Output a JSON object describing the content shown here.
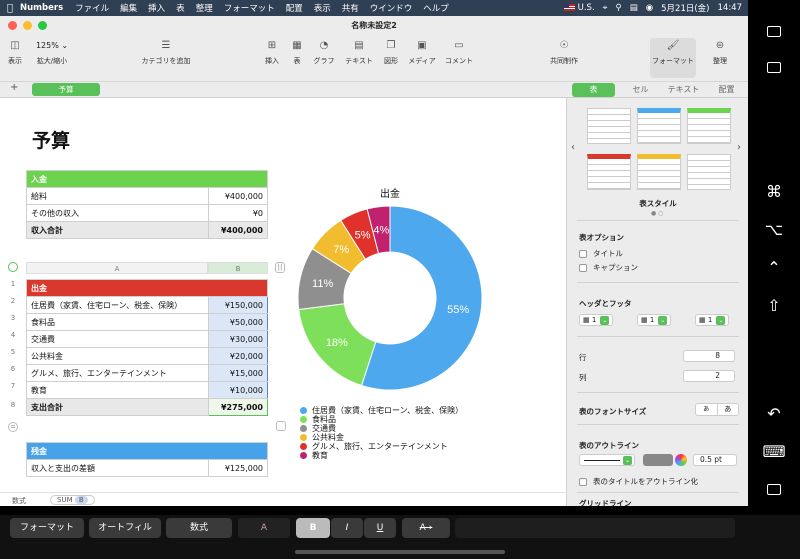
{
  "menubar": {
    "app_name": "Numbers",
    "items": [
      "ファイル",
      "編集",
      "挿入",
      "表",
      "整理",
      "フォーマット",
      "配置",
      "表示",
      "共有",
      "ウインドウ",
      "ヘルプ"
    ],
    "input_source": "U.S.",
    "date": "5月21日(金)",
    "time": "14:47"
  },
  "window": {
    "title": "名称未設定2"
  },
  "toolbar": {
    "view_label": "表示",
    "zoom_value": "125%",
    "zoom_label": "拡大/縮小",
    "add_category_label": "カテゴリを追加",
    "insert_label": "挿入",
    "table_label": "表",
    "chart_label": "グラフ",
    "text_label": "テキスト",
    "shape_label": "図形",
    "media_label": "メディア",
    "comment_label": "コメント",
    "collaborate_label": "共同制作",
    "format_label": "フォーマット",
    "organize_label": "整理"
  },
  "sheet_tab": "予算",
  "inspector_tabs": [
    "表",
    "セル",
    "テキスト",
    "配置"
  ],
  "document": {
    "title": "予算",
    "income_table": {
      "header": "入金",
      "rows": [
        [
          "給料",
          "¥400,000"
        ],
        [
          "その他の収入",
          "¥0"
        ]
      ],
      "footer": [
        "収入合計",
        "¥400,000"
      ]
    },
    "expense_table": {
      "col_headers": [
        "A",
        "B"
      ],
      "header": "出金",
      "rows": [
        [
          "住居費（家賃、住宅ローン、税金、保険）",
          "¥150,000"
        ],
        [
          "食料品",
          "¥50,000"
        ],
        [
          "交通費",
          "¥30,000"
        ],
        [
          "公共料金",
          "¥20,000"
        ],
        [
          "グルメ、旅行、エンターテインメント",
          "¥15,000"
        ],
        [
          "教育",
          "¥10,000"
        ]
      ],
      "footer": [
        "支出合計",
        "¥275,000"
      ],
      "row_numbers": [
        "1",
        "2",
        "3",
        "4",
        "5",
        "6",
        "7",
        "8"
      ]
    },
    "balance_table": {
      "header": "残金",
      "rows": [
        [
          "収入と支出の差額",
          "¥125,000"
        ]
      ]
    }
  },
  "chart_data": {
    "type": "pie",
    "title": "出金",
    "categories": [
      "住居費（家賃、住宅ローン、税金、保険）",
      "食料品",
      "交通費",
      "公共料金",
      "グルメ、旅行、エンターテインメント",
      "教育"
    ],
    "values": [
      55,
      18,
      11,
      7,
      5,
      4
    ],
    "labels": [
      "55%",
      "18%",
      "11%",
      "7%",
      "5%",
      "4%"
    ],
    "colors": [
      "#4ea8ee",
      "#7ee05a",
      "#8f8f8f",
      "#f1bc2e",
      "#e0322a",
      "#c0226e"
    ],
    "legend": "bottom"
  },
  "statusbar": {
    "label": "数式",
    "formula_fn": "SUM",
    "formula_arg": "B"
  },
  "inspector": {
    "table_style_label": "表スタイル",
    "table_options_label": "表オプション",
    "title_label": "タイトル",
    "caption_label": "キャプション",
    "headers_footers_label": "ヘッダとフッタ",
    "header_rows": "1",
    "header_cols": "1",
    "footer_rows": "1",
    "rows_label": "行",
    "rows_value": "8",
    "cols_label": "列",
    "cols_value": "2",
    "font_size_label": "表のフォントサイズ",
    "font_small": "あ",
    "font_large": "あ",
    "outline_label": "表のアウトライン",
    "outline_width": "0.5 pt",
    "outline_title_label": "表のタイトルをアウトライン化",
    "gridlines_label": "グリッドライン"
  },
  "touchbar": {
    "format": "フォーマット",
    "autofill": "オートフィル",
    "formula": "数式",
    "font_color": "A",
    "bold": "B",
    "italic": "I",
    "underline": "U",
    "strike": "A"
  }
}
